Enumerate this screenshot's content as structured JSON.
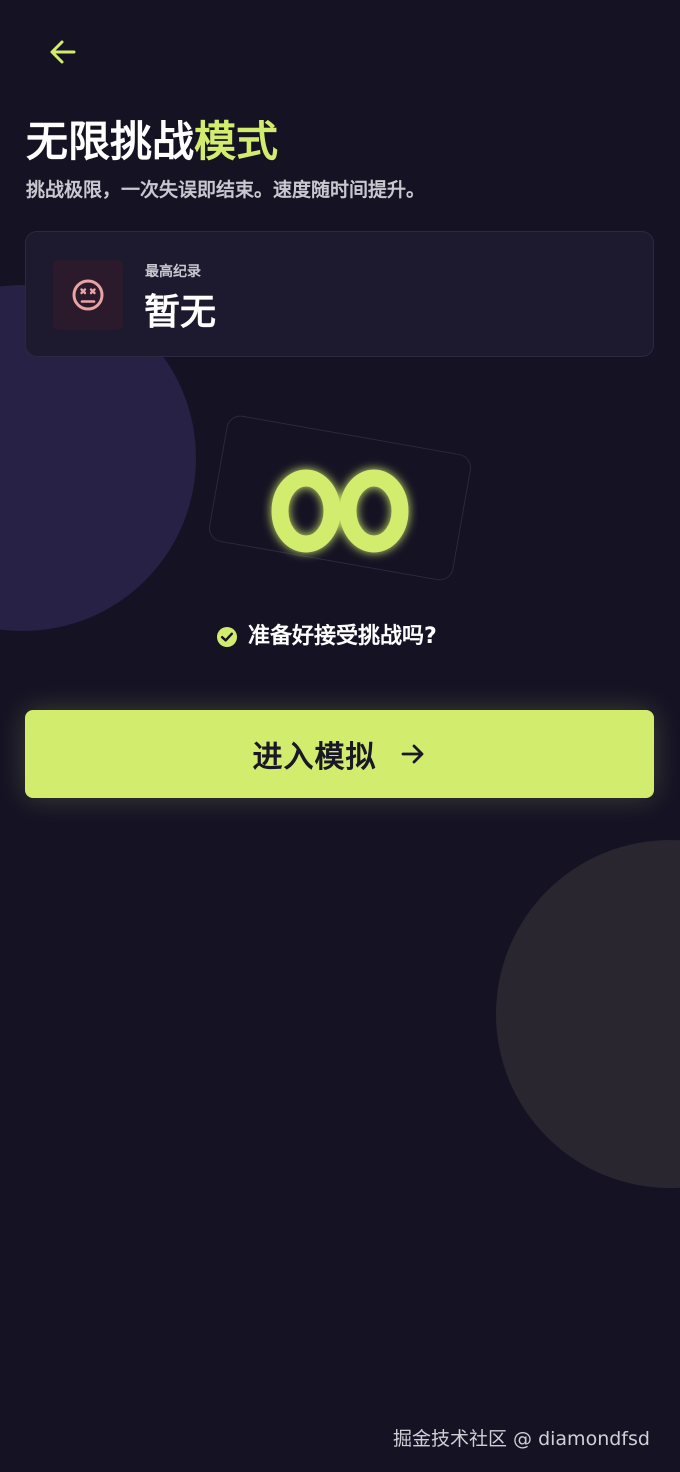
{
  "header": {
    "back_icon": "arrow-left-icon",
    "title_plain": "无限挑战",
    "title_accent": "模式",
    "subtitle": "挑战极限，一次失误即结束。速度随时间提升。"
  },
  "record": {
    "icon": "dizzy-face-icon",
    "label": "最高纪录",
    "value": "暂无"
  },
  "hero": {
    "icon": "infinity-icon"
  },
  "ready": {
    "icon": "check-circle-icon",
    "text": "准备好接受挑战吗?"
  },
  "enter_button": {
    "label": "进入模拟",
    "icon": "arrow-right-icon"
  },
  "watermark": "掘金技术社区 @ diamondfsd",
  "colors": {
    "background": "#151224",
    "accent": "#d2ed6e",
    "card": "#1d1a30",
    "danger_icon": "#e8a4a4"
  }
}
